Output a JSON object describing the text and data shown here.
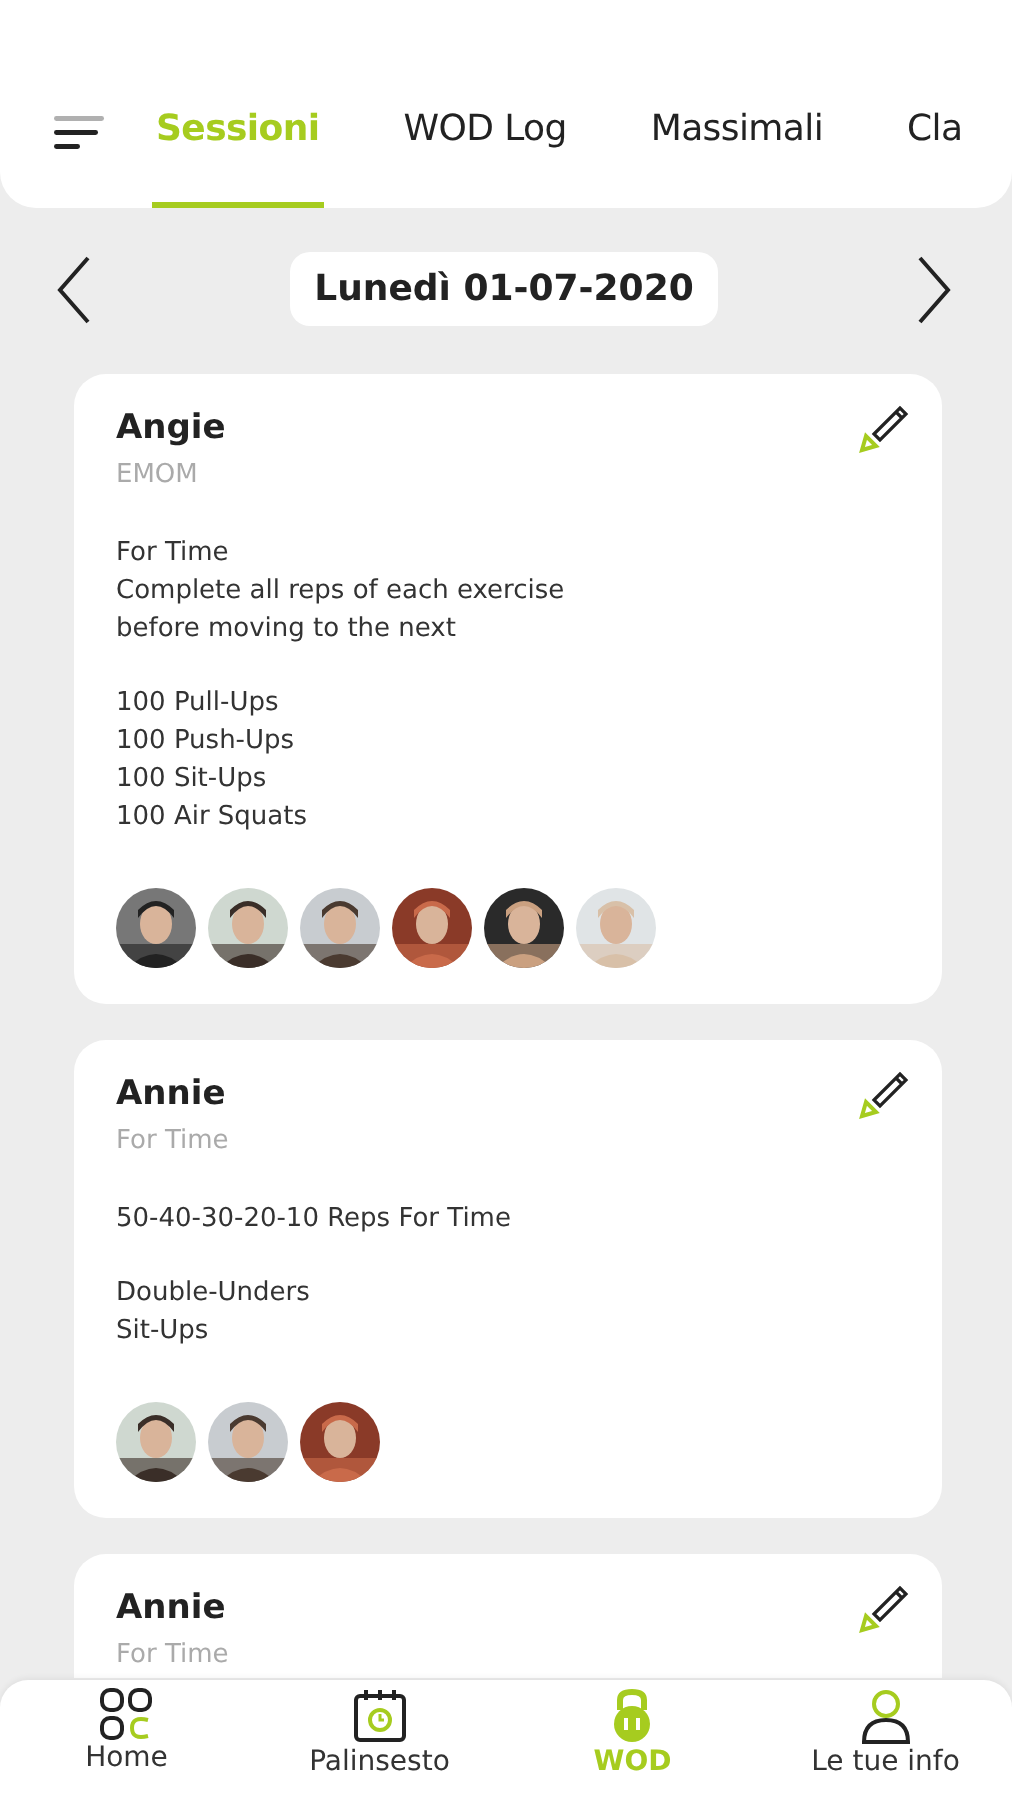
{
  "tabs": [
    {
      "label": "Sessioni",
      "selected": true
    },
    {
      "label": "WOD Log",
      "selected": false
    },
    {
      "label": "Massimali",
      "selected": false
    },
    {
      "label": "Cla",
      "selected": false
    }
  ],
  "date": "Lunedì 01-07-2020",
  "cards": [
    {
      "title": "Angie",
      "subtitle": "EMOM",
      "blocks": [
        [
          "For Time",
          "Complete all reps of each exercise",
          "before moving to the next"
        ],
        [
          "100 Pull-Ups",
          "100 Push-Ups",
          "100 Sit-Ups",
          "100 Air Squats"
        ]
      ],
      "avatars": [
        {
          "kind": "picture"
        },
        {
          "kind": "picture"
        },
        {
          "kind": "picture"
        },
        {
          "kind": "picture"
        },
        {
          "kind": "picture"
        },
        {
          "kind": "picture"
        }
      ]
    },
    {
      "title": "Annie",
      "subtitle": "For Time",
      "blocks": [
        [
          "50-40-30-20-10 Reps For Time"
        ],
        [
          "Double-Unders",
          "Sit-Ups"
        ]
      ],
      "avatars": [
        {
          "kind": "picture"
        },
        {
          "kind": "picture"
        },
        {
          "kind": "picture"
        }
      ]
    },
    {
      "title": "Annie",
      "subtitle": "For Time"
    }
  ],
  "nav": [
    {
      "kind": "home",
      "label": "Home",
      "selected": false
    },
    {
      "kind": "calendar",
      "label": "Palinsesto",
      "selected": false
    },
    {
      "kind": "kettlebell",
      "label": "WOD",
      "selected": true
    },
    {
      "kind": "person",
      "label": "Le tue info",
      "selected": false
    }
  ]
}
